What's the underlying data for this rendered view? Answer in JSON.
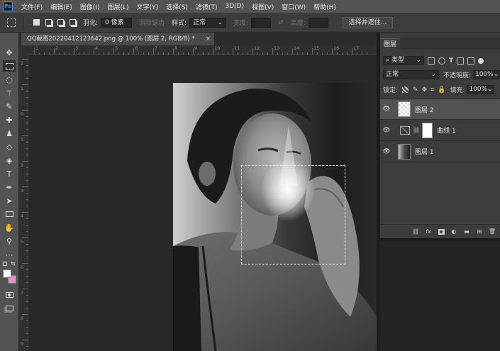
{
  "app": {
    "logo": "Ps"
  },
  "menu": [
    "文件(F)",
    "编辑(E)",
    "图像(I)",
    "图层(L)",
    "文字(Y)",
    "选择(S)",
    "滤镜(T)",
    "3D(D)",
    "视图(V)",
    "窗口(W)",
    "帮助(H)"
  ],
  "options": {
    "feather_label": "羽化:",
    "feather_value": "0 像素",
    "antialias_label": "消除锯齿",
    "style_label": "样式:",
    "style_value": "正常",
    "width_label": "宽度:",
    "height_label": "高度:",
    "select_mask_button": "选择并遮住..."
  },
  "document": {
    "tab_title": "QQ截图20220412123642.png @ 100% (图层 2, RGB/8) *",
    "close": "×"
  },
  "ruler": {
    "h_labels": [
      "1",
      "2",
      "3",
      "4",
      "5",
      "6",
      "7",
      "8",
      "9",
      "10",
      "11",
      "12",
      "13",
      "14",
      "15",
      "16",
      "17"
    ],
    "v_labels": [
      "2",
      "1",
      "0",
      "1",
      "2",
      "3",
      "4",
      "5",
      "6",
      "7",
      "8",
      "9"
    ]
  },
  "layers_panel": {
    "tab": "图层",
    "filter_kind": "类型",
    "blend_mode": "正常",
    "opacity_label": "不透明度:",
    "opacity_value": "100%",
    "lock_label": "锁定:",
    "fill_label": "填充:",
    "fill_value": "100%",
    "layers": [
      {
        "name": "图层 2",
        "selected": true
      },
      {
        "name": "曲线 1",
        "selected": false
      },
      {
        "name": "图层 1",
        "selected": false
      }
    ]
  },
  "colors": {
    "accent": "#31a8ff",
    "background_swatch": "#e78fc2"
  }
}
